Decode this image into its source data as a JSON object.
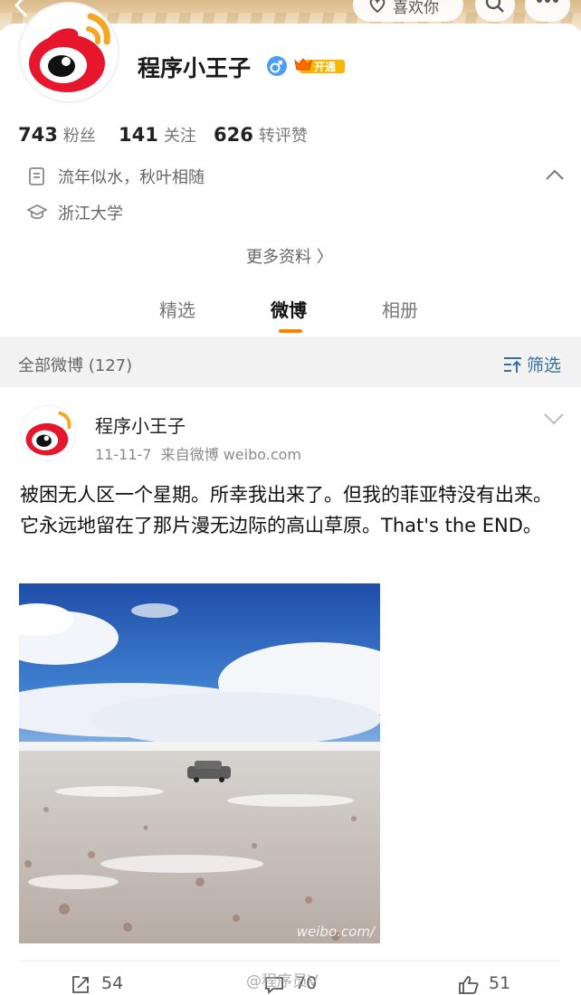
{
  "header": {
    "like_pill_label": "喜欢你"
  },
  "profile": {
    "name": "程序小王子",
    "vip_label": "开通",
    "stats": [
      {
        "value": "743",
        "label": "粉丝"
      },
      {
        "value": "141",
        "label": "关注"
      },
      {
        "value": "626",
        "label": "转评赞"
      }
    ],
    "bio": "流年似水，秋叶相随",
    "school": "浙江大学",
    "more_info": "更多资料 〉"
  },
  "tabs": [
    {
      "label": "精选",
      "active": false
    },
    {
      "label": "微博",
      "active": true
    },
    {
      "label": "相册",
      "active": false
    }
  ],
  "filter": {
    "all_label": "全部微博 (127)",
    "filter_label": "筛选"
  },
  "post": {
    "author": "程序小王子",
    "meta": "11-11-7  来自微博 weibo.com",
    "text": "被困无人区一个星期。所幸我出来了。但我的菲亚特没有出来。它永远地留在了那片漫无边际的高山草原。That's the END。",
    "image_watermark": "weibo.com/",
    "repost_count": "54",
    "comment_count": "70",
    "like_count": "51"
  },
  "overlay_watermark": "@程序员V",
  "colors": {
    "accent": "#ff8200",
    "link": "#3a6ea5",
    "weibo_red": "#e6162d"
  }
}
